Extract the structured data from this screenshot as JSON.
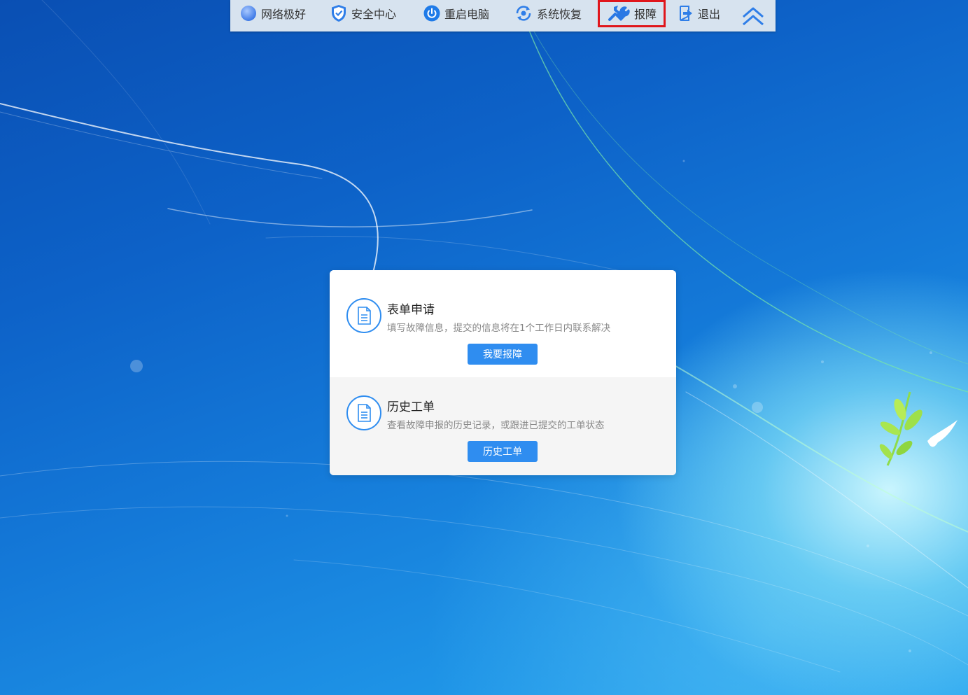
{
  "toolbar": {
    "items": [
      {
        "label": "网络极好",
        "icon": "network-status-icon"
      },
      {
        "label": "安全中心",
        "icon": "shield-icon"
      },
      {
        "label": "重启电脑",
        "icon": "power-icon"
      },
      {
        "label": "系统恢复",
        "icon": "restore-icon"
      },
      {
        "label": "报障",
        "icon": "wrench-icon"
      },
      {
        "label": "退出",
        "icon": "exit-icon"
      }
    ],
    "collapse_icon": "double-chevron-up-icon",
    "highlight_color": "#e0161c"
  },
  "dialog": {
    "form": {
      "title": "表单申请",
      "description": "填写故障信息，提交的信息将在1个工作日内联系解决",
      "button": "我要报障",
      "icon": "document-icon"
    },
    "history": {
      "title": "历史工单",
      "description": "查看故障申报的历史记录，或跟进已提交的工单状态",
      "button": "历史工单",
      "icon": "document-icon"
    },
    "close_icon": "close-icon",
    "accent_color": "#2f8df0"
  }
}
